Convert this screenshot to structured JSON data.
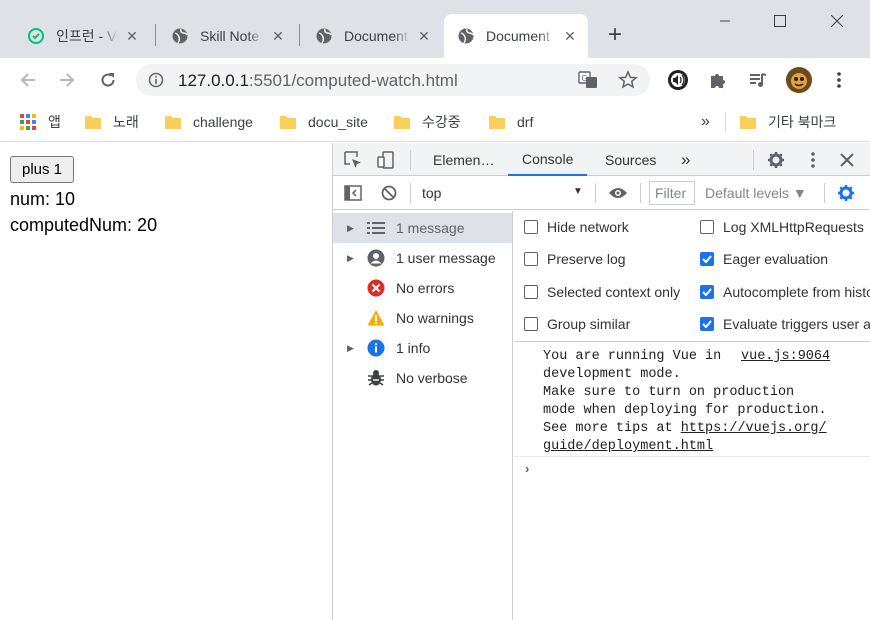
{
  "browser": {
    "tabs": [
      {
        "title": "인프런 - Vue.js",
        "active": false,
        "favicon": "inflearn-icon"
      },
      {
        "title": "Skill Note",
        "active": false,
        "favicon": "globe-icon"
      },
      {
        "title": "Document",
        "active": false,
        "favicon": "globe-icon"
      },
      {
        "title": "Document",
        "active": true,
        "favicon": "globe-icon"
      }
    ],
    "url_host": "127.0.0.1",
    "url_path": ":5501/computed-watch.html"
  },
  "bookmarks": {
    "apps_label": "앱",
    "items": [
      "노래",
      "challenge",
      "docu_site",
      "수강중",
      "drf"
    ],
    "overflow": "»",
    "other_label": "기타 북마크"
  },
  "page": {
    "button_label": "plus 1",
    "num_line": "num: 10",
    "computed_line": "computedNum: 20"
  },
  "devtools": {
    "tabs": [
      "Elemen…",
      "Console",
      "Sources"
    ],
    "more": "»",
    "context": "top",
    "filter_placeholder": "Filter",
    "levels": "Default levels ▼",
    "sidebar": [
      {
        "label": "1 message",
        "icon": "list-icon",
        "caret": true
      },
      {
        "label": "1 user message",
        "icon": "user-icon",
        "caret": true
      },
      {
        "label": "No errors",
        "icon": "error-icon",
        "caret": false
      },
      {
        "label": "No warnings",
        "icon": "warning-icon",
        "caret": false
      },
      {
        "label": "1 info",
        "icon": "info-icon",
        "caret": true
      },
      {
        "label": "No verbose",
        "icon": "bug-icon",
        "caret": false
      }
    ],
    "settings": [
      {
        "label": "Hide network",
        "checked": false
      },
      {
        "label": "Log XMLHttpRequests",
        "checked": false
      },
      {
        "label": "Preserve log",
        "checked": false
      },
      {
        "label": "Eager evaluation",
        "checked": true
      },
      {
        "label": "Selected context only",
        "checked": false
      },
      {
        "label": "Autocomplete from history",
        "checked": true
      },
      {
        "label": "Group similar",
        "checked": false
      },
      {
        "label": "Evaluate triggers user activation",
        "checked": true
      }
    ],
    "message": {
      "line1": "You are running Vue in",
      "line2": "development mode.",
      "line3": "Make sure to turn on production",
      "line4": "mode when deploying for production.",
      "line5": "See more tips at ",
      "link1": "https://vuejs.org/",
      "link2": "guide/deployment.html",
      "source": "vue.js:9064"
    },
    "prompt": "›"
  },
  "colors": {
    "accent": "#1a73e8",
    "error": "#d93025",
    "warning": "#f9ab00",
    "tabstrip": "#dee1e6"
  }
}
